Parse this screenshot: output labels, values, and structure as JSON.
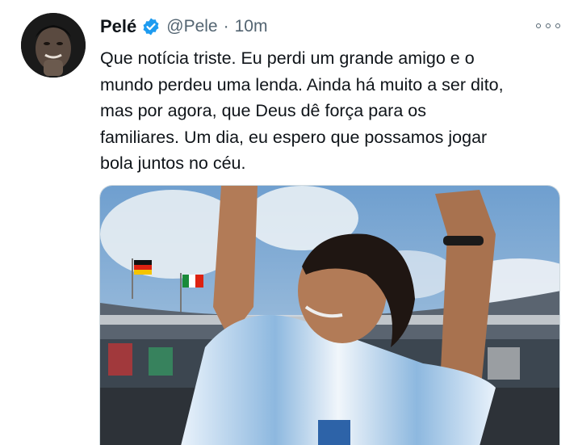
{
  "tweet": {
    "author_name": "Pelé",
    "author_handle": "@Pele",
    "separator": "·",
    "timestamp": "10m",
    "verified": true,
    "text_lines": [
      "Que notícia triste. Eu perdi um grande amigo e o",
      "mundo perdeu uma lenda. Ainda há muito a ser dito,",
      "mas por agora, que Deus dê força para os",
      "familiares. Um dia, eu espero que possamos jogar",
      "bola juntos no céu."
    ],
    "media": {
      "description_icon": "photo-football-player-celebrating"
    }
  },
  "colors": {
    "verified_blue": "#1d9bf0",
    "text_primary": "#0f1419",
    "text_secondary": "#536471"
  },
  "icons": {
    "verified": "verified-badge-icon",
    "more": "more-options-icon"
  }
}
